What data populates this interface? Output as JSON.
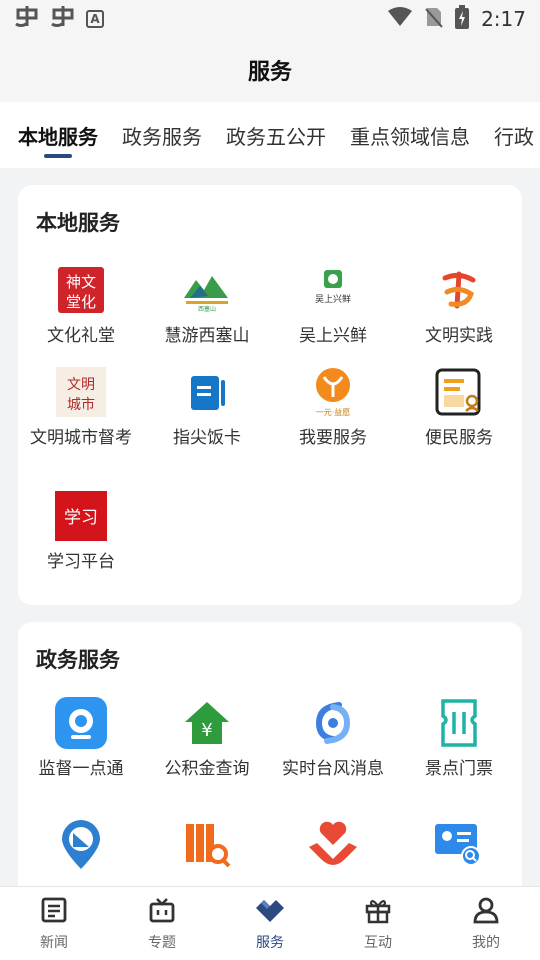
{
  "status_bar": {
    "left_icons": [
      "notification-icon",
      "notification-icon",
      "a-box-icon"
    ],
    "time": "2:17",
    "right_icons": [
      "wifi-icon",
      "no-sim-icon",
      "battery-icon"
    ]
  },
  "header": {
    "title": "服务"
  },
  "tabs": [
    {
      "label": "本地服务",
      "active": true
    },
    {
      "label": "政务服务"
    },
    {
      "label": "政务五公开"
    },
    {
      "label": "重点领域信息"
    },
    {
      "label": "行政"
    }
  ],
  "local_services": {
    "title": "本地服务",
    "items": [
      {
        "label": "文化礼堂",
        "icon": "culture-hall-icon"
      },
      {
        "label": "慧游西塞山",
        "icon": "tour-xisaishan-icon"
      },
      {
        "label": "吴上兴鲜",
        "icon": "wushang-xingxian-icon"
      },
      {
        "label": "文明实践",
        "icon": "civilization-practice-icon"
      },
      {
        "label": "文明城市督考",
        "icon": "civilized-city-icon"
      },
      {
        "label": "指尖饭卡",
        "icon": "meal-card-icon"
      },
      {
        "label": "我要服务",
        "icon": "i-want-service-icon",
        "sub": "一元·益愿"
      },
      {
        "label": "便民服务",
        "icon": "convenience-service-icon"
      },
      {
        "label": "学习平台",
        "icon": "study-platform-icon"
      }
    ]
  },
  "gov_services": {
    "title": "政务服务",
    "items": [
      {
        "label": "监督一点通",
        "icon": "supervision-camera-icon"
      },
      {
        "label": "公积金查询",
        "icon": "housing-fund-icon"
      },
      {
        "label": "实时台风消息",
        "icon": "typhoon-icon"
      },
      {
        "label": "景点门票",
        "icon": "ticket-icon"
      },
      {
        "label": "",
        "icon": "map-pin-icon"
      },
      {
        "label": "",
        "icon": "archive-search-icon"
      },
      {
        "label": "",
        "icon": "heart-hands-icon"
      },
      {
        "label": "",
        "icon": "id-card-search-icon"
      }
    ]
  },
  "bottom_nav": [
    {
      "label": "新闻",
      "icon": "news-icon"
    },
    {
      "label": "专题",
      "icon": "tv-icon"
    },
    {
      "label": "服务",
      "icon": "service-icon",
      "active": true
    },
    {
      "label": "互动",
      "icon": "gift-icon"
    },
    {
      "label": "我的",
      "icon": "profile-icon"
    }
  ]
}
